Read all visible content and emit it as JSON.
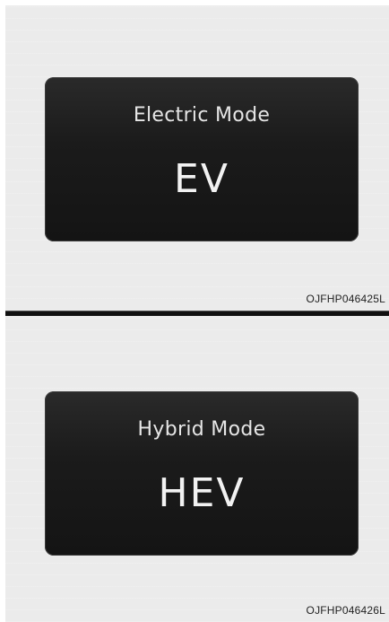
{
  "figures": [
    {
      "screen_title": "Electric Mode",
      "screen_code": "EV",
      "reference": "OJFHP046425L"
    },
    {
      "screen_title": "Hybrid Mode",
      "screen_code": "HEV",
      "reference": "OJFHP046426L"
    }
  ]
}
